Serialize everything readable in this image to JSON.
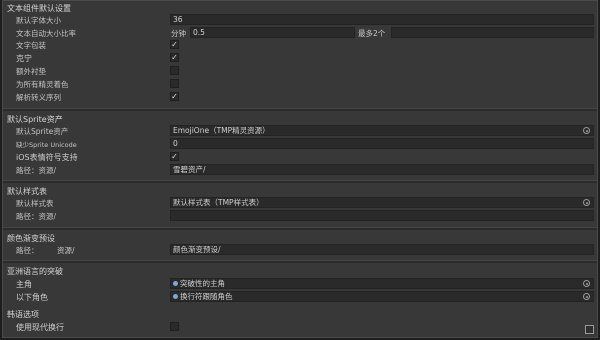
{
  "text_component_defaults": {
    "header": "文本组件默认设置",
    "font_size_label": "默认字体大小",
    "font_size_value": "36",
    "auto_size_label": "文本自动大小比率",
    "min_label": "分钟",
    "min_value": "0.5",
    "max_label": "最多2个",
    "word_wrap_label": "文字包装",
    "word_wrap_check": "✓",
    "kerning_label": "克宁",
    "kerning_check": "✓",
    "extra_padding_label": "额外衬垫",
    "tint_sprites_label": "为所有精灵着色",
    "parse_escape_label": "解析转义序列",
    "parse_escape_check": "✓"
  },
  "default_sprite_asset": {
    "header": "默认Sprite资产",
    "asset_label": "默认Sprite资产",
    "asset_value": "EmojiOne（TMP精灵资源）",
    "missing_unicode_label": "缺少Sprite Unicode",
    "missing_unicode_value": "0",
    "ios_emoji_label": "iOS表情符号支持",
    "ios_emoji_check": "✓",
    "path_label": "路径：资源/",
    "path_value": "雪碧资产/"
  },
  "default_style_sheet": {
    "header": "默认样式表",
    "sheet_label": "默认样式表",
    "sheet_value": "默认样式表（TMP样式表）",
    "path_label": "路径：资源/",
    "path_value": ""
  },
  "color_gradient_presets": {
    "header": "颜色渐变预设",
    "path_label": "路径：",
    "path_label2": "资源/",
    "path_value": "颜色渐变预设/"
  },
  "asian_line_breaking": {
    "header": "亚洲语言的突破",
    "leading_label": "主角",
    "leading_value": "突破性的主角",
    "following_label": "以下角色",
    "following_value": "换行符跟随角色"
  },
  "korean": {
    "header": "韩语选项",
    "modern_label": "使用现代换行"
  }
}
